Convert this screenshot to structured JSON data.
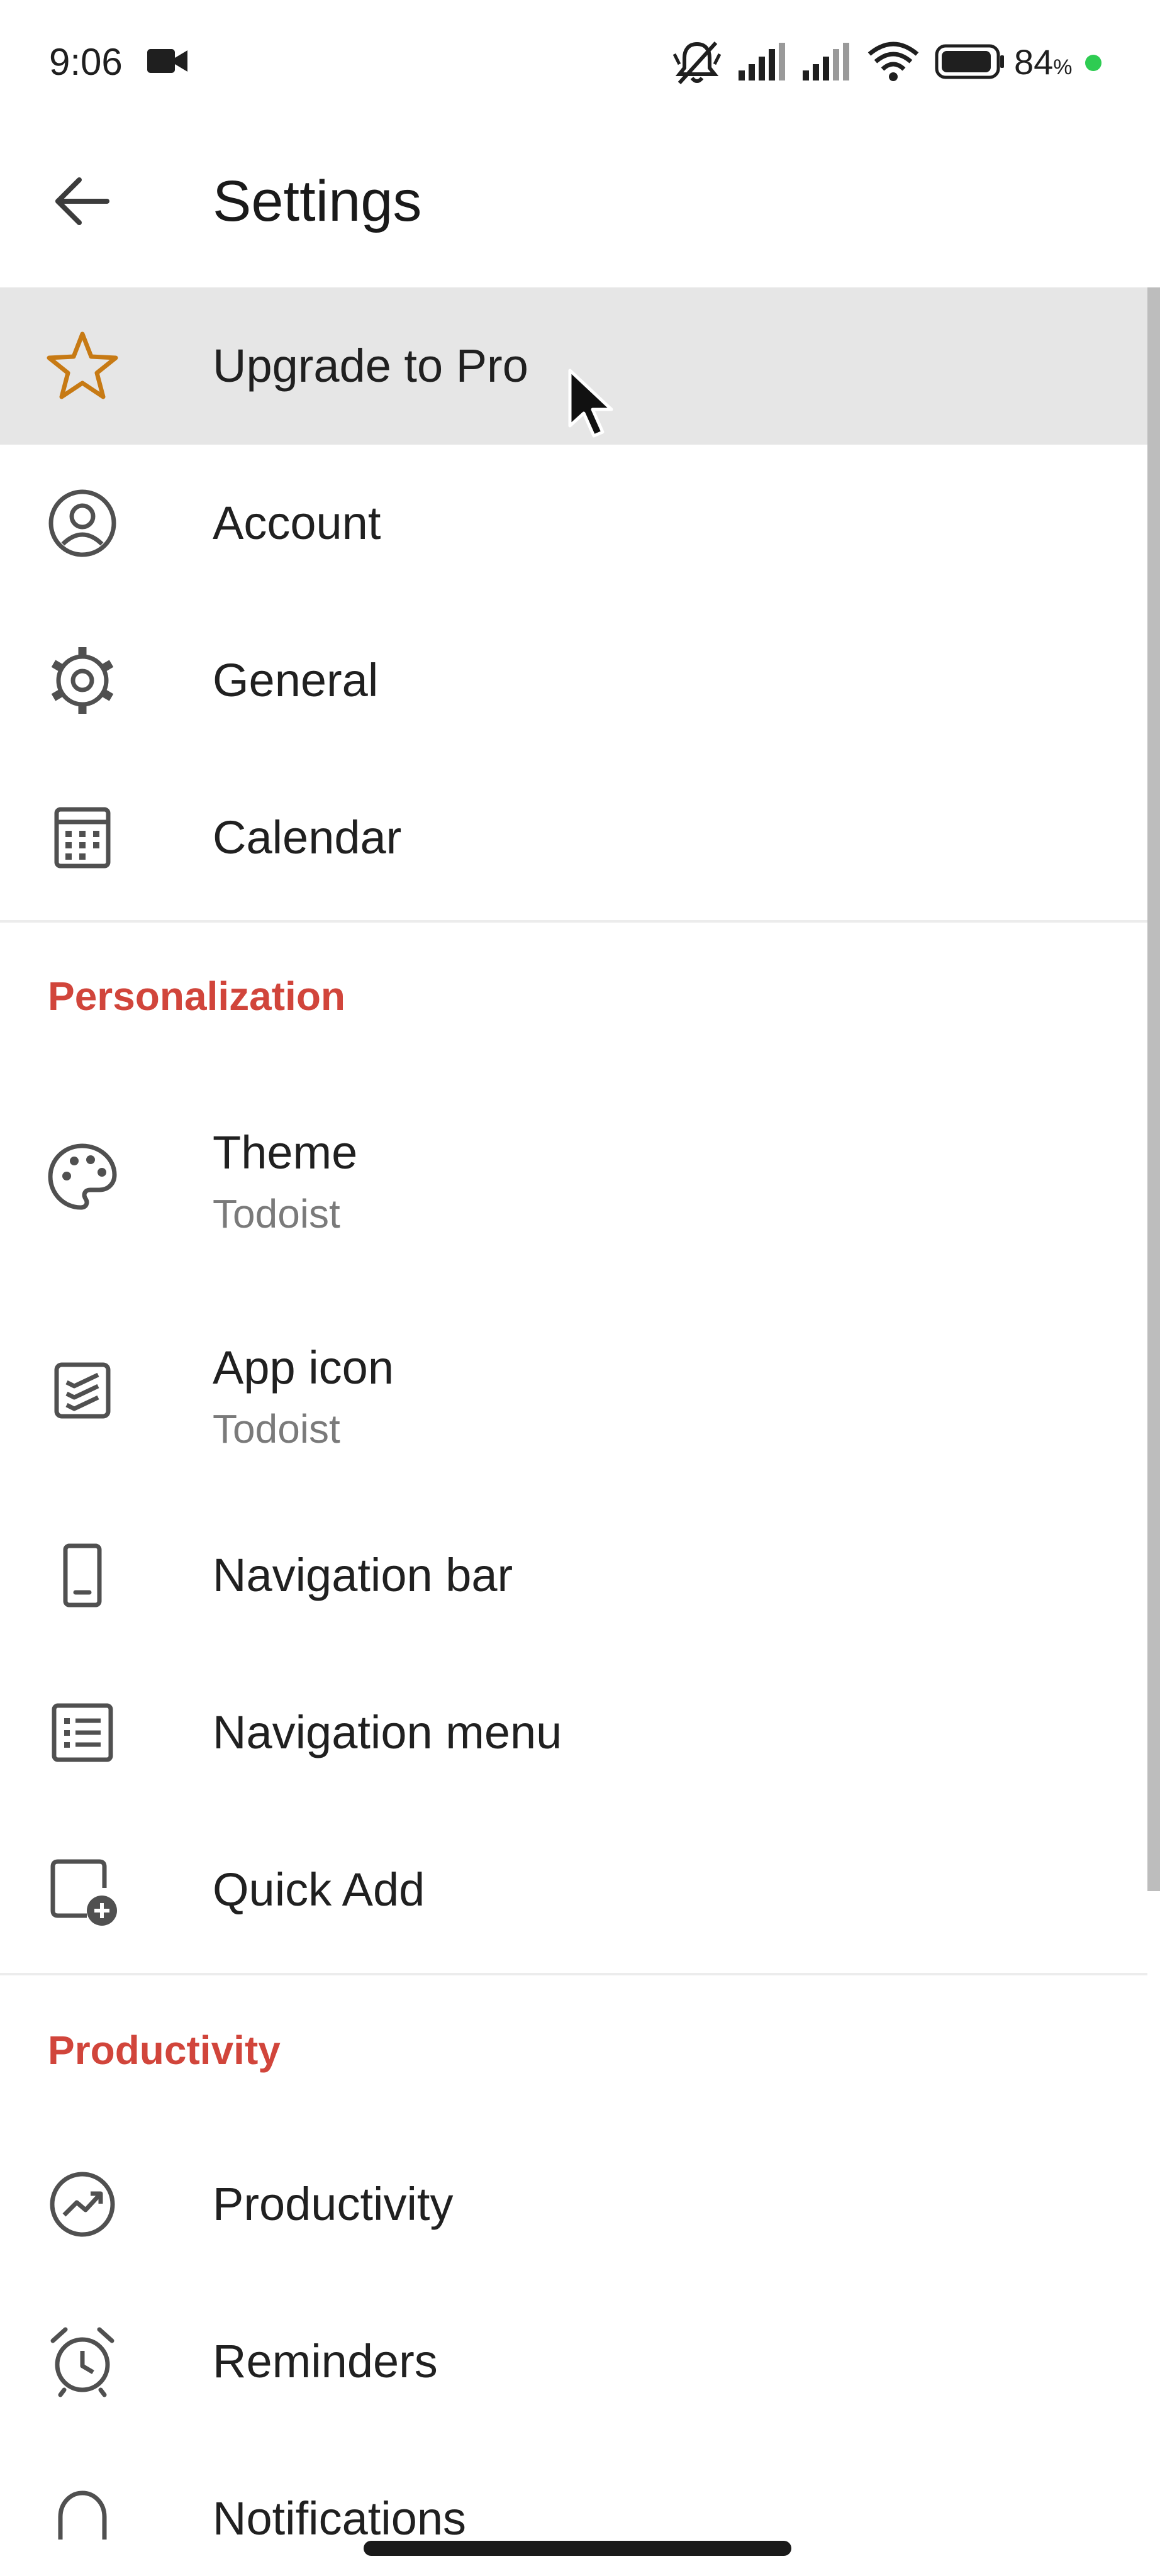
{
  "status_bar": {
    "time": "9:06",
    "battery_percent": "84",
    "battery_percent_sign": "%",
    "icons": [
      "video-camera-icon",
      "silent-mode-icon",
      "signal-icon",
      "signal-icon",
      "wifi-icon",
      "battery-icon"
    ],
    "privacy_dot_color": "#2ecc52"
  },
  "app_bar": {
    "title": "Settings",
    "back_icon": "back-arrow-icon"
  },
  "sections": {
    "personalization": "Personalization",
    "productivity": "Productivity"
  },
  "items": {
    "upgrade": {
      "label": "Upgrade to Pro",
      "icon": "star-icon"
    },
    "account": {
      "label": "Account",
      "icon": "account-circle-icon"
    },
    "general": {
      "label": "General",
      "icon": "gear-icon"
    },
    "calendar": {
      "label": "Calendar",
      "icon": "calendar-icon"
    },
    "theme": {
      "label": "Theme",
      "value": "Todoist",
      "icon": "palette-icon"
    },
    "app_icon": {
      "label": "App icon",
      "value": "Todoist",
      "icon": "app-icon-icon"
    },
    "navigation_bar": {
      "label": "Navigation bar",
      "icon": "phone-icon"
    },
    "navigation_menu": {
      "label": "Navigation menu",
      "icon": "list-icon"
    },
    "quick_add": {
      "label": "Quick Add",
      "icon": "quick-add-icon"
    },
    "productivity": {
      "label": "Productivity",
      "icon": "trend-icon"
    },
    "reminders": {
      "label": "Reminders",
      "icon": "alarm-icon"
    },
    "notifications": {
      "label": "Notifications",
      "icon": "bell-icon"
    }
  },
  "colors": {
    "accent": "#d1453b",
    "star": "#c77a14",
    "highlight": "#e6e6e6"
  }
}
